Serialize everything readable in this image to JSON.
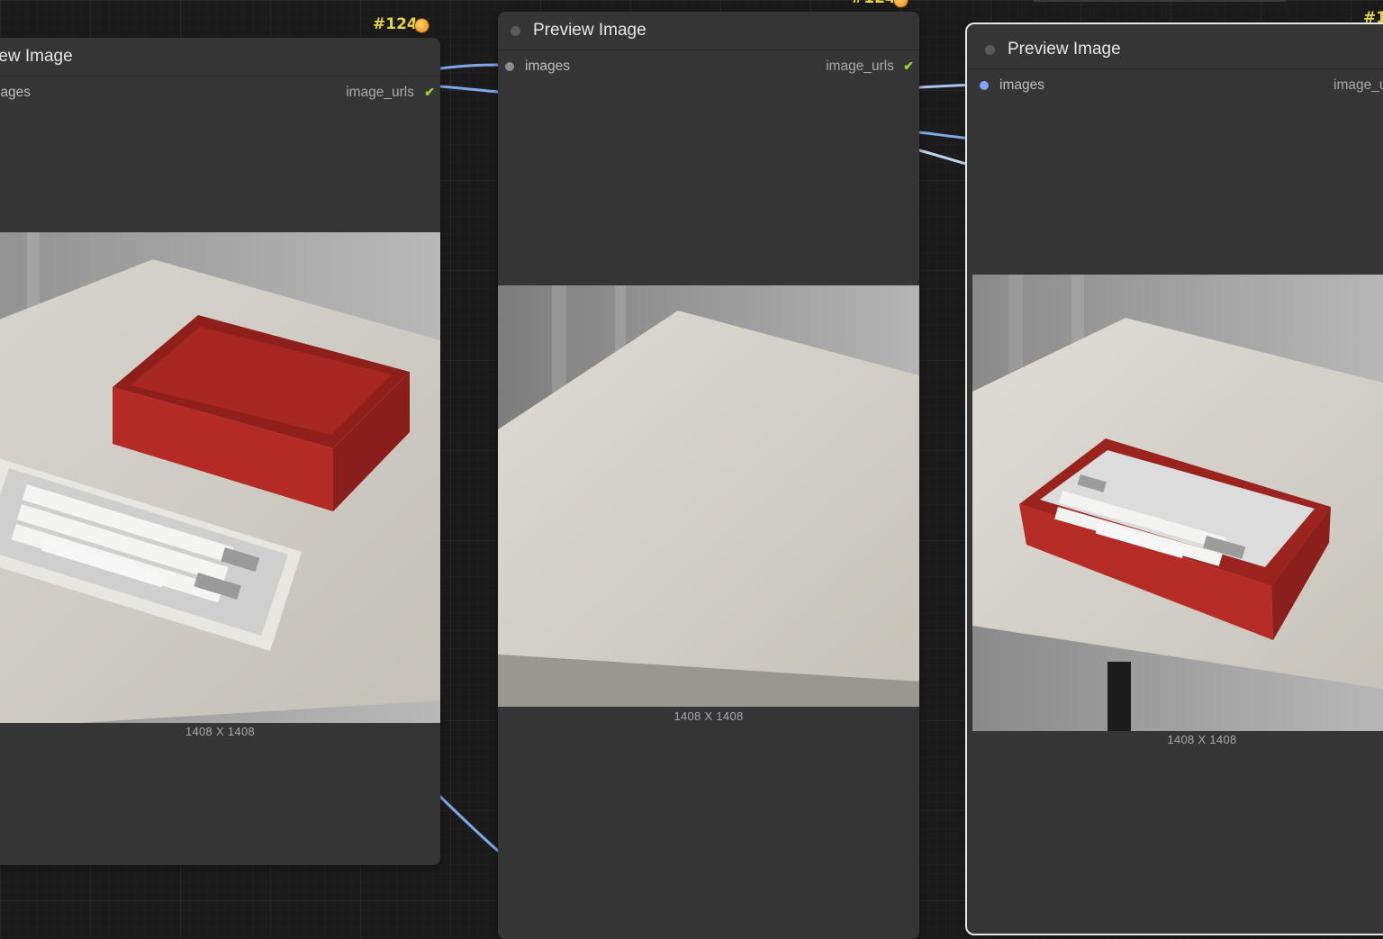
{
  "colors": {
    "canvas": "#1b1b1b",
    "node_body": "#353535",
    "wire_blue": "#7ea8e8",
    "wire_light": "#bcd2f0",
    "badge": "#e4d44a",
    "check": "#9dd23a",
    "input_dot_connected": "#7fa3f0",
    "input_dot_idle": "#8c8c8c"
  },
  "nodes": [
    {
      "title": "Preview Image",
      "badge": "#124",
      "input_label": "images",
      "output_label": "image_urls",
      "output_status_icon": "check-icon",
      "image_dimensions": "1408  X 1408",
      "image_content": "red-open-box-beside-white-grey-mechanical-keyboard-on-white-table"
    },
    {
      "title": "Preview Image",
      "badge": "#124",
      "input_label": "images",
      "output_label": "image_urls",
      "output_status_icon": "check-icon",
      "image_dimensions": "1408  X 1408",
      "image_content": "empty-white-table-top"
    },
    {
      "title": "Preview Image",
      "badge": "#1",
      "input_label": "images",
      "output_label": "image_u",
      "image_dimensions": "1408  X 1408",
      "image_content": "mechanical-keyboard-inside-red-box-on-white-table"
    }
  ]
}
